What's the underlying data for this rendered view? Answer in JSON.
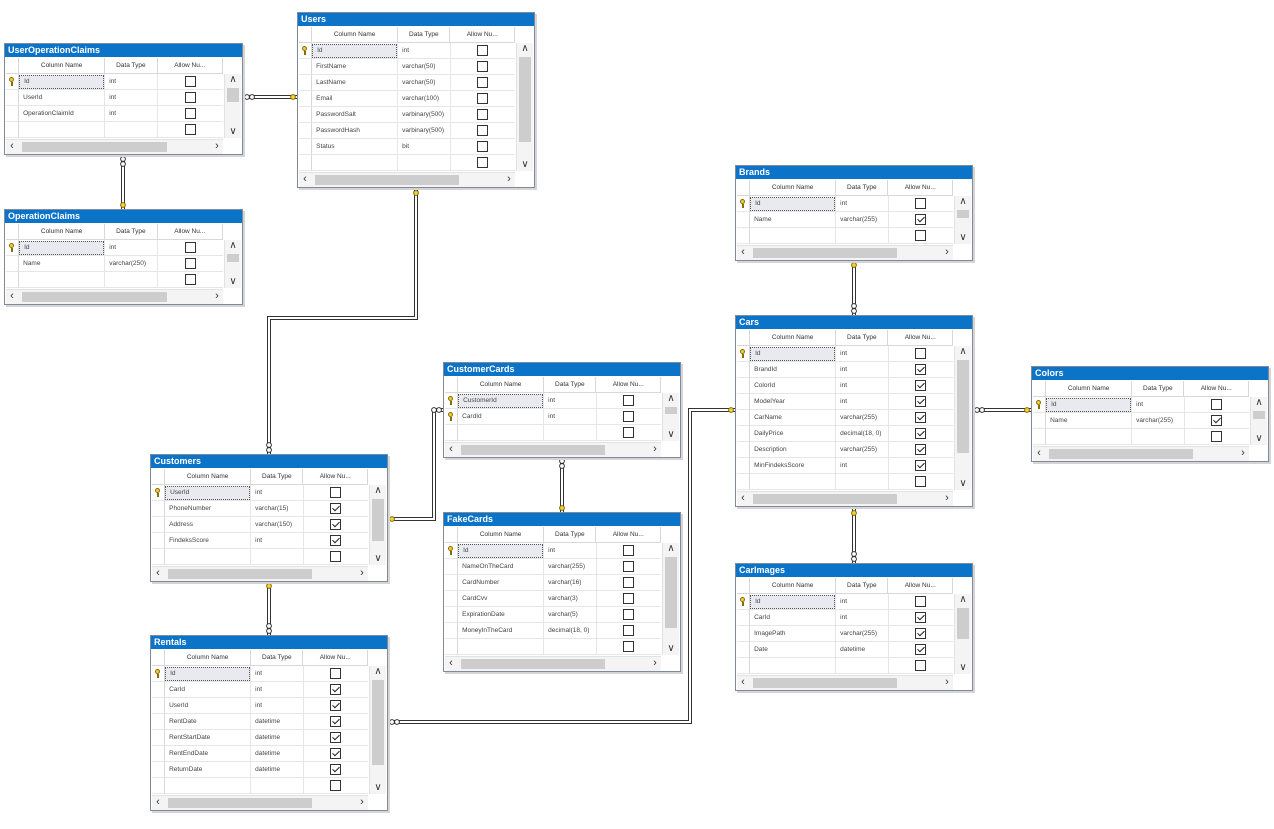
{
  "header_labels": {
    "column_name": "Column Name",
    "data_type": "Data Type",
    "allow_nulls": "Allow Nu..."
  },
  "tables": [
    {
      "name": "UserOperationClaims",
      "rows": [
        {
          "name": "Id",
          "type": "int",
          "nulls": false,
          "key": true
        },
        {
          "name": "UserId",
          "type": "int",
          "nulls": false,
          "key": false
        },
        {
          "name": "OperationClaimId",
          "type": "int",
          "nulls": false,
          "key": false
        }
      ]
    },
    {
      "name": "Users",
      "rows": [
        {
          "name": "Id",
          "type": "int",
          "nulls": false,
          "key": true
        },
        {
          "name": "FirstName",
          "type": "varchar(50)",
          "nulls": false,
          "key": false
        },
        {
          "name": "LastName",
          "type": "varchar(50)",
          "nulls": false,
          "key": false
        },
        {
          "name": "Email",
          "type": "varchar(100)",
          "nulls": false,
          "key": false
        },
        {
          "name": "PasswordSalt",
          "type": "varbinary(500)",
          "nulls": false,
          "key": false
        },
        {
          "name": "PasswordHash",
          "type": "varbinary(500)",
          "nulls": false,
          "key": false
        },
        {
          "name": "Status",
          "type": "bit",
          "nulls": false,
          "key": false
        }
      ]
    },
    {
      "name": "OperationClaims",
      "rows": [
        {
          "name": "Id",
          "type": "int",
          "nulls": false,
          "key": true
        },
        {
          "name": "Name",
          "type": "varchar(250)",
          "nulls": false,
          "key": false
        }
      ]
    },
    {
      "name": "Brands",
      "rows": [
        {
          "name": "Id",
          "type": "int",
          "nulls": false,
          "key": true
        },
        {
          "name": "Name",
          "type": "varchar(255)",
          "nulls": true,
          "key": false
        }
      ]
    },
    {
      "name": "Cars",
      "rows": [
        {
          "name": "Id",
          "type": "int",
          "nulls": false,
          "key": true
        },
        {
          "name": "BrandId",
          "type": "int",
          "nulls": true,
          "key": false
        },
        {
          "name": "ColorId",
          "type": "int",
          "nulls": true,
          "key": false
        },
        {
          "name": "ModelYear",
          "type": "int",
          "nulls": true,
          "key": false
        },
        {
          "name": "CarName",
          "type": "varchar(255)",
          "nulls": true,
          "key": false
        },
        {
          "name": "DailyPrice",
          "type": "decimal(18, 0)",
          "nulls": true,
          "key": false
        },
        {
          "name": "Description",
          "type": "varchar(255)",
          "nulls": true,
          "key": false
        },
        {
          "name": "MinFindeksScore",
          "type": "int",
          "nulls": true,
          "key": false
        }
      ]
    },
    {
      "name": "Colors",
      "rows": [
        {
          "name": "Id",
          "type": "int",
          "nulls": false,
          "key": true
        },
        {
          "name": "Name",
          "type": "varchar(255)",
          "nulls": true,
          "key": false
        }
      ]
    },
    {
      "name": "CustomerCards",
      "rows": [
        {
          "name": "CustomerId",
          "type": "int",
          "nulls": false,
          "key": true
        },
        {
          "name": "CardId",
          "type": "int",
          "nulls": false,
          "key": true
        }
      ]
    },
    {
      "name": "FakeCards",
      "rows": [
        {
          "name": "Id",
          "type": "int",
          "nulls": false,
          "key": true
        },
        {
          "name": "NameOnTheCard",
          "type": "varchar(255)",
          "nulls": false,
          "key": false
        },
        {
          "name": "CardNumber",
          "type": "varchar(16)",
          "nulls": false,
          "key": false
        },
        {
          "name": "CardCvv",
          "type": "varchar(3)",
          "nulls": false,
          "key": false
        },
        {
          "name": "ExpirationDate",
          "type": "varchar(5)",
          "nulls": false,
          "key": false
        },
        {
          "name": "MoneyInTheCard",
          "type": "decimal(18, 0)",
          "nulls": false,
          "key": false
        }
      ]
    },
    {
      "name": "Customers",
      "rows": [
        {
          "name": "UserId",
          "type": "int",
          "nulls": false,
          "key": true
        },
        {
          "name": "PhoneNumber",
          "type": "varchar(15)",
          "nulls": true,
          "key": false
        },
        {
          "name": "Address",
          "type": "varchar(150)",
          "nulls": true,
          "key": false
        },
        {
          "name": "FindeksScore",
          "type": "int",
          "nulls": true,
          "key": false
        }
      ]
    },
    {
      "name": "CarImages",
      "rows": [
        {
          "name": "Id",
          "type": "int",
          "nulls": false,
          "key": true
        },
        {
          "name": "CarId",
          "type": "int",
          "nulls": true,
          "key": false
        },
        {
          "name": "ImagePath",
          "type": "varchar(255)",
          "nulls": true,
          "key": false
        },
        {
          "name": "Date",
          "type": "datetime",
          "nulls": true,
          "key": false
        }
      ]
    },
    {
      "name": "Rentals",
      "rows": [
        {
          "name": "Id",
          "type": "int",
          "nulls": false,
          "key": true
        },
        {
          "name": "CarId",
          "type": "int",
          "nulls": true,
          "key": false
        },
        {
          "name": "UserId",
          "type": "int",
          "nulls": true,
          "key": false
        },
        {
          "name": "RentDate",
          "type": "datetime",
          "nulls": true,
          "key": false
        },
        {
          "name": "RentStartDate",
          "type": "datetime",
          "nulls": true,
          "key": false
        },
        {
          "name": "RentEndDate",
          "type": "datetime",
          "nulls": true,
          "key": false
        },
        {
          "name": "ReturnDate",
          "type": "datetime",
          "nulls": true,
          "key": false
        }
      ]
    }
  ],
  "relationships": [
    {
      "from": "UserOperationClaims",
      "to": "Users"
    },
    {
      "from": "UserOperationClaims",
      "to": "OperationClaims"
    },
    {
      "from": "Customers",
      "to": "Users"
    },
    {
      "from": "CustomerCards",
      "to": "Customers"
    },
    {
      "from": "CustomerCards",
      "to": "FakeCards"
    },
    {
      "from": "Rentals",
      "to": "Customers"
    },
    {
      "from": "Rentals",
      "to": "Cars"
    },
    {
      "from": "Cars",
      "to": "Brands"
    },
    {
      "from": "Cars",
      "to": "Colors"
    },
    {
      "from": "CarImages",
      "to": "Cars"
    }
  ],
  "theme": {
    "title_bar": "#0b73c8",
    "link_line": "#333333",
    "key_icon": "#f3cf3c"
  }
}
